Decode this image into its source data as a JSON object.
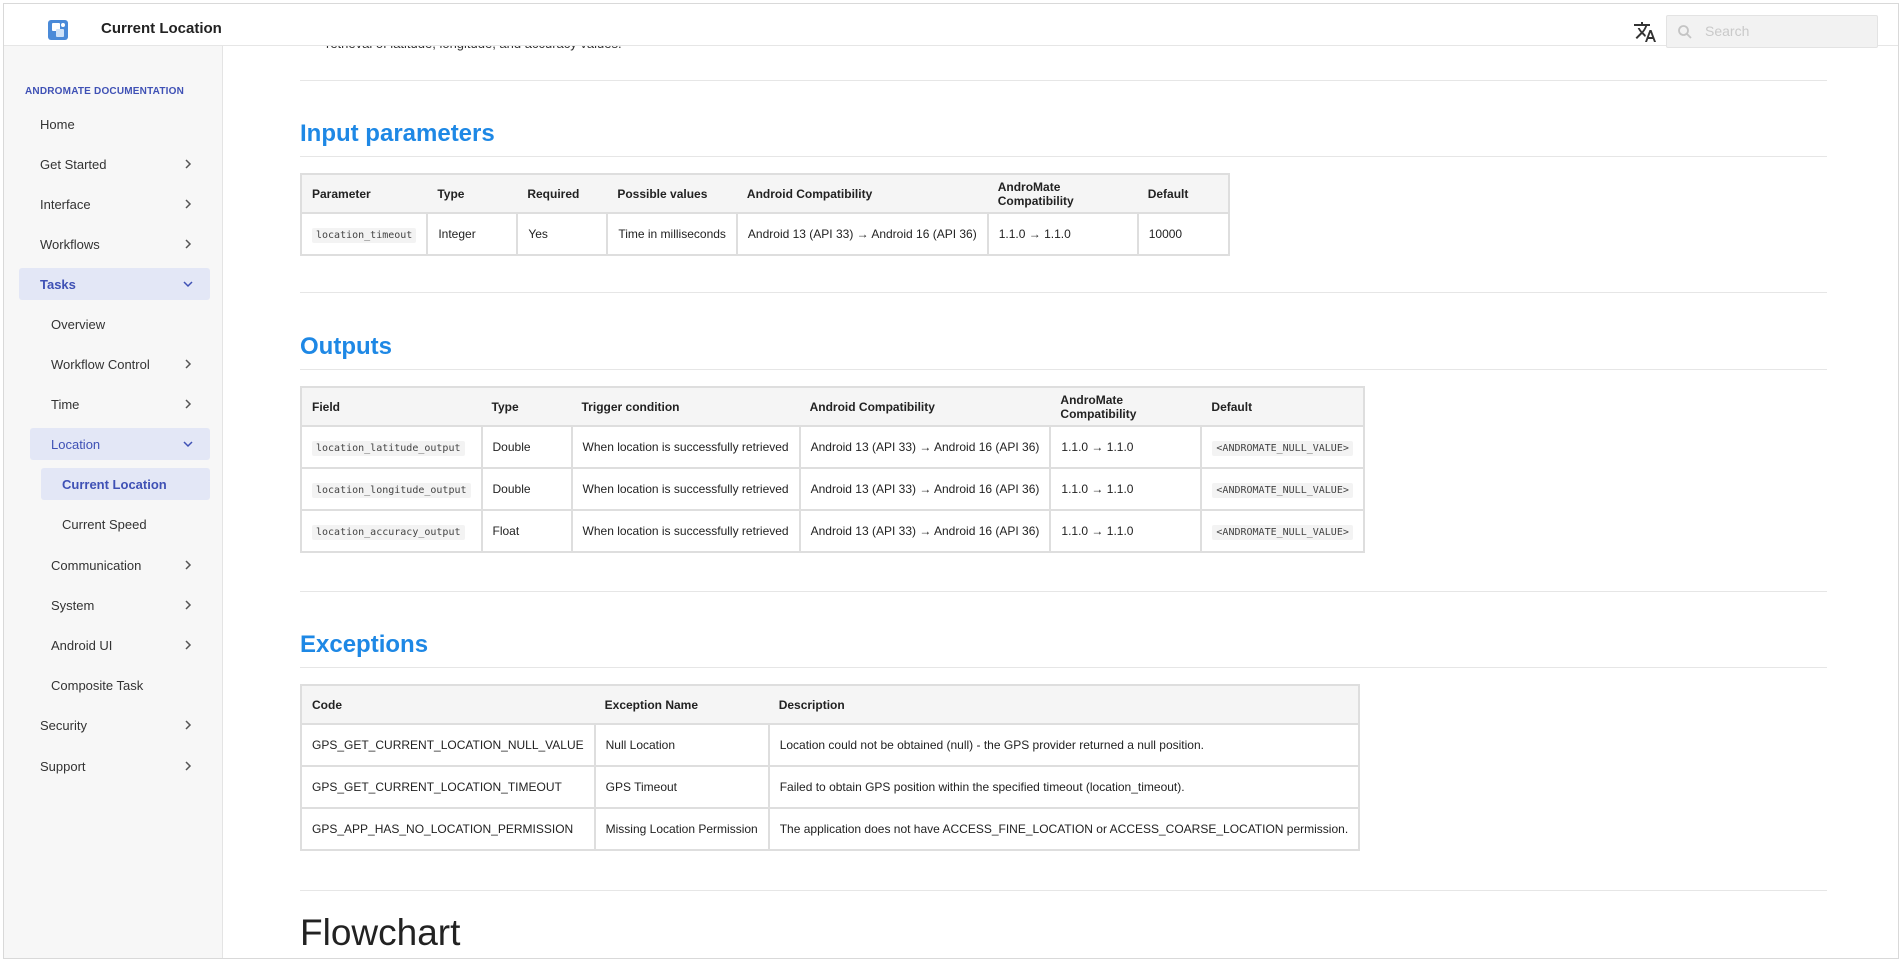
{
  "header": {
    "title": "Current Location",
    "search_placeholder": "Search"
  },
  "sidebar": {
    "heading": "ANDROMATE DOCUMENTATION",
    "items": [
      {
        "label": "Home"
      },
      {
        "label": "Get Started"
      },
      {
        "label": "Interface"
      },
      {
        "label": "Workflows"
      },
      {
        "label": "Tasks"
      },
      {
        "label": "Overview"
      },
      {
        "label": "Workflow Control"
      },
      {
        "label": "Time"
      },
      {
        "label": "Location"
      },
      {
        "label": "Current Location"
      },
      {
        "label": "Current Speed"
      },
      {
        "label": "Communication"
      },
      {
        "label": "System"
      },
      {
        "label": "Android UI"
      },
      {
        "label": "Composite Task"
      },
      {
        "label": "Security"
      },
      {
        "label": "Support"
      }
    ]
  },
  "main": {
    "top_text": "retrieval of latitude, longitude, and accuracy values.",
    "input_parameters": {
      "title": "Input parameters",
      "headers": [
        "Parameter",
        "Type",
        "Required",
        "Possible values",
        "Android Compatibility",
        "AndroMate Compatibility",
        "Default"
      ],
      "rows": [
        [
          "location_timeout",
          "Integer",
          "Yes",
          "Time in milliseconds",
          "Android 13 (API 33) → Android 16 (API 36)",
          "1.1.0 → 1.1.0",
          "10000"
        ]
      ]
    },
    "outputs": {
      "title": "Outputs",
      "headers": [
        "Field",
        "Type",
        "Trigger condition",
        "Android Compatibility",
        "AndroMate Compatibility",
        "Default"
      ],
      "rows": [
        [
          "location_latitude_output",
          "Double",
          "When location is successfully retrieved",
          "Android 13 (API 33) → Android 16 (API 36)",
          "1.1.0 → 1.1.0",
          "<ANDROMATE_NULL_VALUE>"
        ],
        [
          "location_longitude_output",
          "Double",
          "When location is successfully retrieved",
          "Android 13 (API 33) → Android 16 (API 36)",
          "1.1.0 → 1.1.0",
          "<ANDROMATE_NULL_VALUE>"
        ],
        [
          "location_accuracy_output",
          "Float",
          "When location is successfully retrieved",
          "Android 13 (API 33) → Android 16 (API 36)",
          "1.1.0 → 1.1.0",
          "<ANDROMATE_NULL_VALUE>"
        ]
      ]
    },
    "exceptions": {
      "title": "Exceptions",
      "headers": [
        "Code",
        "Exception Name",
        "Description"
      ],
      "rows": [
        [
          "GPS_GET_CURRENT_LOCATION_NULL_VALUE",
          "Null Location",
          "Location could not be obtained (null) - the GPS provider returned a null position."
        ],
        [
          "GPS_GET_CURRENT_LOCATION_TIMEOUT",
          "GPS Timeout",
          "Failed to obtain GPS position within the specified timeout (location_timeout)."
        ],
        [
          "GPS_APP_HAS_NO_LOCATION_PERMISSION",
          "Missing Location Permission",
          "The application does not have ACCESS_FINE_LOCATION or ACCESS_COARSE_LOCATION permission."
        ]
      ]
    },
    "flowchart_title": "Flowchart"
  },
  "colors": {
    "accent": "#3f51b5",
    "heading_blue": "#1e88e5"
  }
}
